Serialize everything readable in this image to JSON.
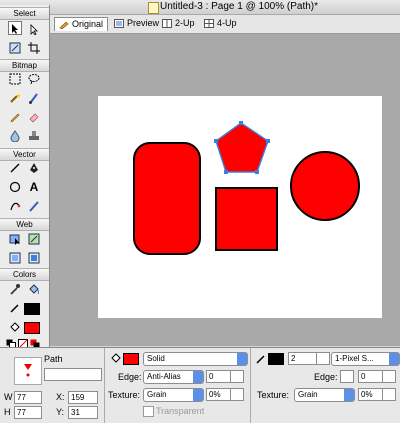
{
  "window": {
    "title": "Untitled-3 : Page 1 @ 100% (Path)*"
  },
  "tabs": [
    {
      "label": "Original",
      "active": true
    },
    {
      "label": "Preview",
      "active": false
    },
    {
      "label": "2-Up",
      "active": false
    },
    {
      "label": "4-Up",
      "active": false
    }
  ],
  "toolbar": {
    "sections": [
      "Select",
      "Bitmap",
      "Vector",
      "Web",
      "Colors"
    ]
  },
  "canvas": {
    "fill_color": "#ff0000",
    "stroke_color": "#000000"
  },
  "properties": {
    "object_type": "Path",
    "name_value": "",
    "width_label": "W",
    "width_value": "77",
    "height_label": "H",
    "height_value": "77",
    "x_label": "X:",
    "x_value": "159",
    "y_label": "Y:",
    "y_value": "31",
    "fill": {
      "type": "Solid",
      "edge_label": "Edge:",
      "edge_value": "Anti-Alias",
      "edge_amount": "0",
      "texture_label": "Texture:",
      "texture_value": "Grain",
      "texture_amount": "0%",
      "transparent_label": "Transparent",
      "color": "#ff0000"
    },
    "stroke": {
      "size": "2",
      "type": "1-Pixel S...",
      "edge_label": "Edge:",
      "edge_amount": "0",
      "texture_label": "Texture:",
      "texture_value": "Grain",
      "texture_amount": "0%",
      "color": "#000000"
    }
  }
}
